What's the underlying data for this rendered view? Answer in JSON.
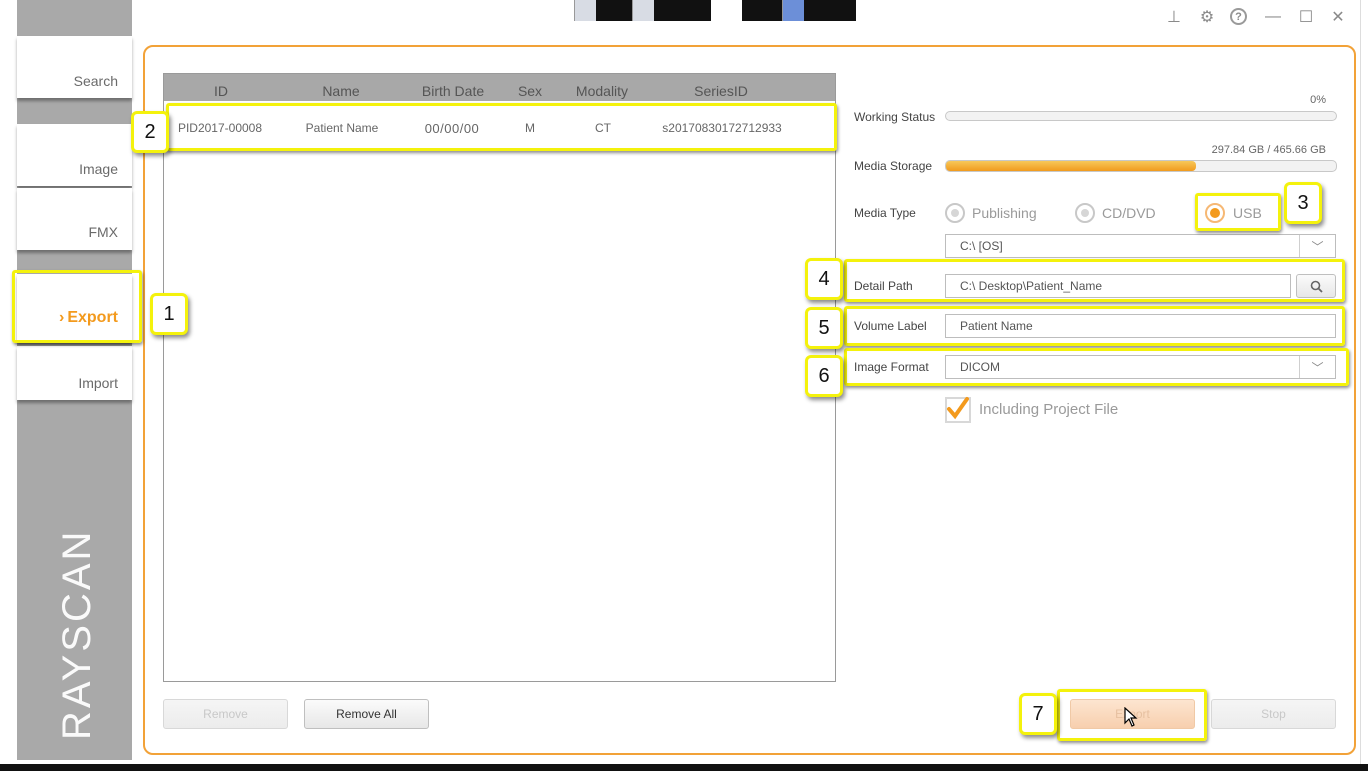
{
  "window_controls": [
    {
      "name": "pin-icon",
      "glyph": "⊥"
    },
    {
      "name": "settings-gear-icon",
      "glyph": "⚙"
    },
    {
      "name": "help-icon",
      "glyph": "?"
    },
    {
      "name": "minimize-icon",
      "glyph": "—"
    },
    {
      "name": "maximize-icon",
      "glyph": "☐"
    },
    {
      "name": "close-icon",
      "glyph": "✕"
    }
  ],
  "sidebar": {
    "items": [
      {
        "label": "Search"
      },
      {
        "label": "Image"
      },
      {
        "label": "FMX"
      },
      {
        "label": "Export",
        "active": true
      },
      {
        "label": "Import"
      }
    ],
    "active_marker": "›",
    "brand": "RAYSCAN"
  },
  "table": {
    "columns": [
      "ID",
      "Name",
      "Birth Date",
      "Sex",
      "Modality",
      "SeriesID"
    ],
    "rows": [
      {
        "id": "PID2017-00008",
        "name": "Patient Name",
        "birth_date": "00/00/00",
        "sex": "M",
        "modality": "CT",
        "series_id": "s20170830172712933"
      }
    ]
  },
  "buttons": {
    "remove": "Remove",
    "remove_all": "Remove All",
    "export": "Export",
    "stop": "Stop"
  },
  "form": {
    "working_status": {
      "label": "Working Status",
      "percent_text": "0%",
      "progress": 0
    },
    "media_storage": {
      "label": "Media Storage",
      "usage_text": "297.84 GB / 465.66 GB",
      "used_fraction": 0.64
    },
    "media_type": {
      "label": "Media Type",
      "options": [
        "Publishing",
        "CD/DVD",
        "USB"
      ],
      "selected": "USB"
    },
    "drive": {
      "value": "C:\\ [OS]"
    },
    "detail_path": {
      "label": "Detail Path",
      "value": "C:\\ Desktop\\Patient_Name"
    },
    "volume_label": {
      "label": "Volume Label",
      "value": "Patient Name"
    },
    "image_format": {
      "label": "Image Format",
      "value": "DICOM"
    },
    "include_project": {
      "label": "Including Project File",
      "checked": true
    }
  },
  "callouts": [
    "1",
    "2",
    "3",
    "4",
    "5",
    "6",
    "7"
  ],
  "colors": {
    "accent": "#f39a1d",
    "highlight": "#f4f20c",
    "sidebar": "#a9a9a9"
  }
}
